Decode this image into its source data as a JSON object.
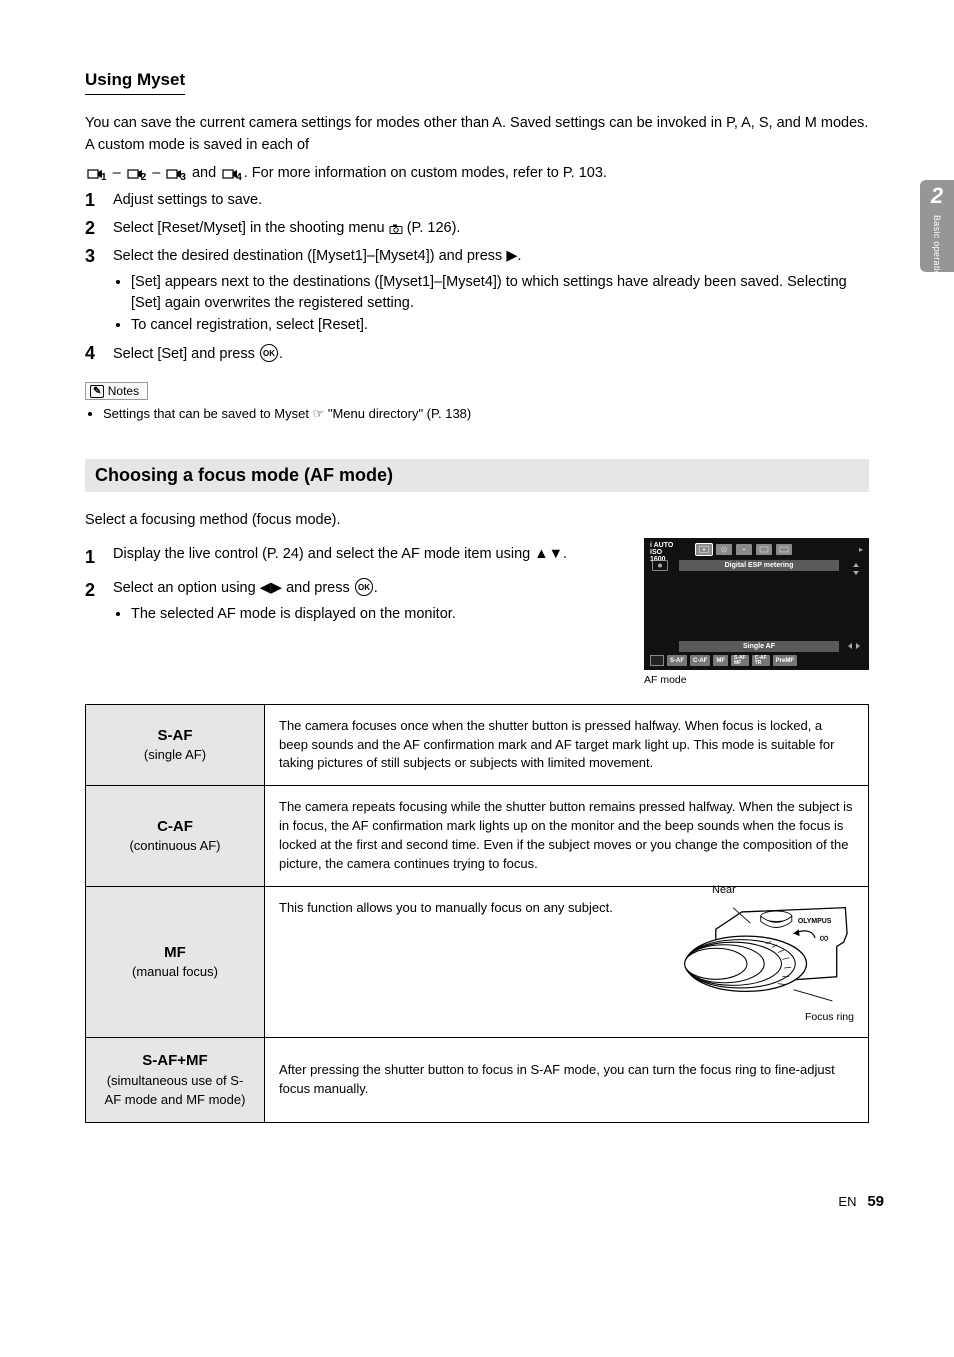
{
  "side_tab": {
    "num": "2",
    "text": "Basic operations"
  },
  "myset": {
    "title": "Using Myset",
    "intro": "You can save the current camera settings for modes other than A. Saved settings can be invoked in P, A, S, and M modes. A custom mode is saved in each of ",
    "intro2": ". For more information on custom modes, refer to P. 103.",
    "step1_lead": "Adjust settings to save.",
    "step2_lead1": "Select [Reset/Myset] in the shooting menu ",
    "step2_lead2": " (P. 126).",
    "step3_lead": "Select the desired destination ([Myset1]–[Myset4]) and press ",
    "step3_lead2": ".",
    "step3_b1": "[Set] appears next to the destinations ([Myset1]–[Myset4]) to which settings have already been saved. Selecting [Set] again overwrites the registered setting.",
    "step3_b2": "To cancel registration, select [Reset].",
    "step4_lead": "Select [Set] and press ",
    "step4_lead2": ".",
    "notes_heading": "Notes",
    "note1": "Settings that can be saved to Myset ",
    "note1_ref": "g",
    "note1_suffix": " \"Menu directory\" (P. 138)"
  },
  "af": {
    "section_title": "Choosing a focus mode (AF mode)",
    "lead": "Select a focusing method (focus mode).",
    "step1_a": "Display the live control (P. 24) and select the AF mode item using ",
    "step1_b": ".",
    "step2_a": "Select an option using ",
    "step2_b": " and press ",
    "step2_c": ".",
    "step2_bullet": "The selected AF mode is displayed on the monitor.",
    "panel": {
      "iso": "i AUTO",
      "iso2": "ISO\n1600",
      "metering_label": "Digital ESP metering",
      "af_label": "Single AF",
      "opts": [
        "S-AF",
        "C-AF",
        "MF",
        "S-AF\nMF",
        "C-AF\nTR",
        "PreMF"
      ]
    },
    "panel_caption": "AF mode",
    "rows": {
      "saf": {
        "name": "S-AF",
        "desc": "(single AF)",
        "text": "The camera focuses once when the shutter button is pressed halfway. When focus is locked, a beep sounds and the AF confirmation mark and AF target mark light up. This mode is suitable for taking pictures of still subjects or subjects with limited movement."
      },
      "caf": {
        "name": "C-AF",
        "desc": "(continuous AF)",
        "text": "The camera repeats focusing while the shutter button remains pressed halfway. When the subject is in focus, the AF confirmation mark lights up on the monitor and the beep sounds when the focus is locked at the first and second time. Even if the subject moves or you change the composition of the picture, the camera continues trying to focus."
      },
      "mf": {
        "name": "MF",
        "desc": "(manual focus)",
        "text": "This function allows you to manually focus on any subject.",
        "near_label": "Near",
        "inf_icon": "∞",
        "ring_label": "Focus ring"
      },
      "safmf": {
        "name": "S-AF+MF",
        "desc": "(simultaneous use of S-AF mode and MF mode)",
        "text": "After pressing the shutter button to focus in S-AF mode, you can turn the focus ring to fine-adjust focus manually."
      }
    }
  },
  "footer": {
    "en": "EN",
    "page": "59"
  }
}
